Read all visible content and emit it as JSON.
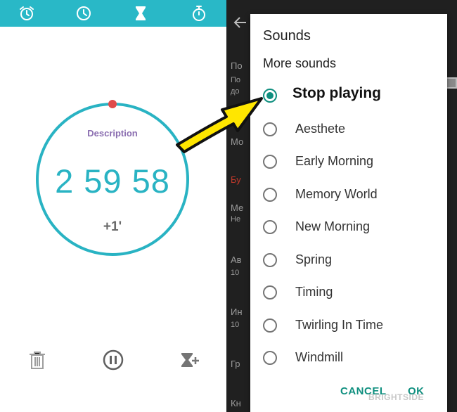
{
  "colors": {
    "teal_bar": "#29b8c7",
    "ring": "#29b3c3",
    "ring_dot": "#e04b4b",
    "description": "#8a6db0",
    "dialog_accent": "#0f8f7f",
    "arrow_fill": "#ffe600",
    "dark_bg": "#202020"
  },
  "top_bar": {
    "icons": [
      "alarm-icon",
      "clock-icon",
      "hourglass-icon",
      "stopwatch-icon"
    ]
  },
  "timer": {
    "description": "Description",
    "time": "2 59 58",
    "plus_label": "+1'"
  },
  "bottom_bar": {
    "icons": [
      "trash-icon",
      "pause-icon",
      "add-timer-icon"
    ]
  },
  "background_settings": {
    "lines": [
      "По",
      "По",
      "до",
      "Мо",
      "Бу",
      "Ме",
      "Не",
      "Ав",
      "10",
      "Ин",
      "10",
      "Гр",
      "Кн"
    ]
  },
  "dialog": {
    "title": "Sounds",
    "subtitle": "More sounds",
    "selected_index": 0,
    "options": [
      "Stop playing",
      "Aesthete",
      "Early Morning",
      "Memory World",
      "New Morning",
      "Spring",
      "Timing",
      "Twirling In Time",
      "Windmill"
    ],
    "cancel_label": "CANCEL",
    "ok_label": "OK"
  },
  "watermark": "BRIGHTSIDE"
}
